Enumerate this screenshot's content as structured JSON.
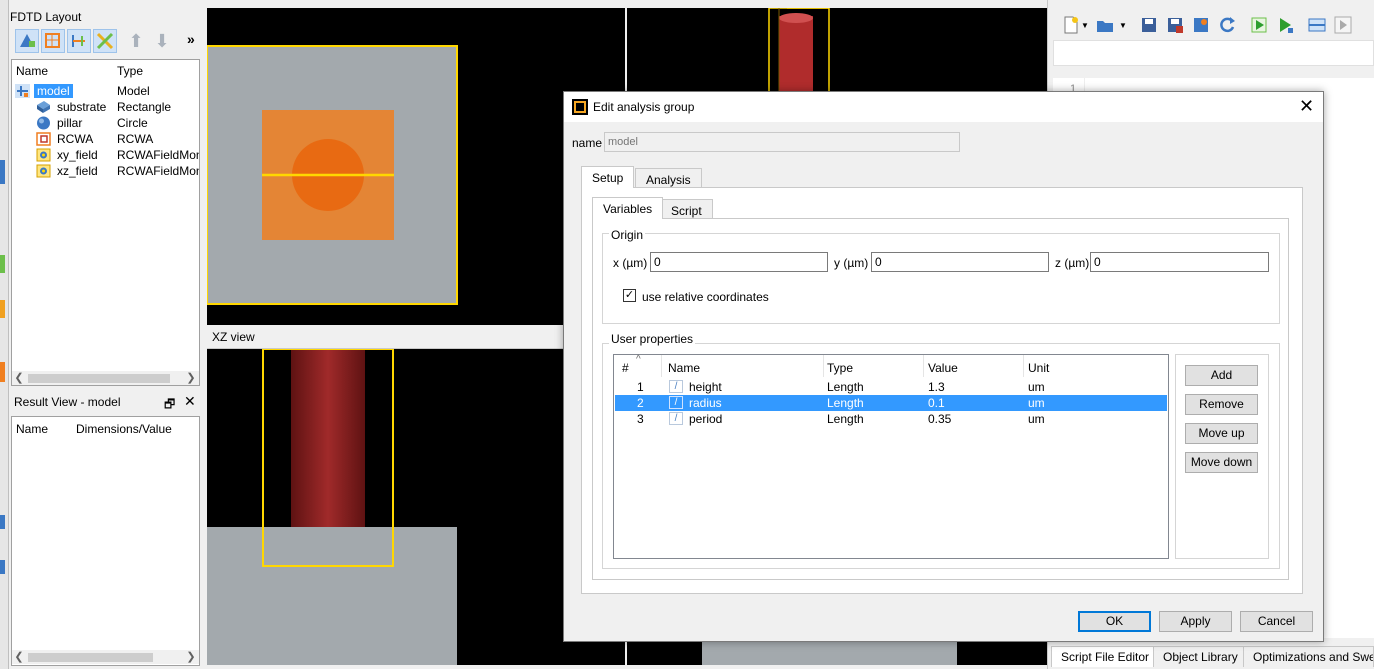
{
  "layout_panel": {
    "title": "FDTD Layout",
    "more": "»",
    "columns": {
      "name": "Name",
      "type": "Type"
    },
    "tree": [
      {
        "name": "model",
        "type": "Model",
        "icon": "model-icon",
        "selected": true
      },
      {
        "name": "substrate",
        "type": "Rectangle",
        "icon": "rectangle-icon"
      },
      {
        "name": "pillar",
        "type": "Circle",
        "icon": "circle-icon"
      },
      {
        "name": "RCWA",
        "type": "RCWA",
        "icon": "rcwa-icon"
      },
      {
        "name": "xy_field",
        "type": "RCWAFieldMon",
        "icon": "field-monitor-icon"
      },
      {
        "name": "xz_field",
        "type": "RCWAFieldMon",
        "icon": "field-monitor-icon"
      }
    ]
  },
  "result_panel": {
    "title": "Result View - model",
    "float": "🗗",
    "close": "✕",
    "columns": {
      "name": "Name",
      "value": "Dimensions/Value"
    }
  },
  "views": {
    "xz_title": "XZ view"
  },
  "script_editor": {
    "line_number": "1",
    "bottom_tabs": [
      "Script File Editor",
      "Object Library",
      "Optimizations and Sweep"
    ]
  },
  "dialog": {
    "title": "Edit analysis group",
    "close": "✕",
    "name_label": "name",
    "name_placeholder": "model",
    "tabs": [
      "Setup",
      "Analysis"
    ],
    "subtabs": [
      "Variables",
      "Script"
    ],
    "origin": {
      "label": "Origin",
      "x_label": "x (µm)",
      "x_value": "0",
      "y_label": "y (µm)",
      "y_value": "0",
      "z_label": "z (µm)",
      "z_value": "0"
    },
    "use_relative": {
      "label": "use relative coordinates",
      "checked": true,
      "mark": "✓"
    },
    "user_properties": {
      "label": "User properties",
      "sort_mark": "^",
      "columns": [
        "#",
        "Name",
        "Type",
        "Value",
        "Unit"
      ],
      "rows": [
        {
          "index": "1",
          "icon": "/",
          "name": "height",
          "type": "Length",
          "value": "1.3",
          "unit": "um"
        },
        {
          "index": "2",
          "icon": "/",
          "name": "radius",
          "type": "Length",
          "value": "0.1",
          "unit": "um",
          "selected": true
        },
        {
          "index": "3",
          "icon": "/",
          "name": "period",
          "type": "Length",
          "value": "0.35",
          "unit": "um"
        }
      ],
      "buttons": [
        "Add",
        "Remove",
        "Move up",
        "Move down"
      ]
    },
    "footer": {
      "ok": "OK",
      "apply": "Apply",
      "cancel": "Cancel"
    }
  },
  "colors": {
    "selection": "#3399ff",
    "substrate": "#a3a9ad",
    "pillar": "#f07f20",
    "monitor": "#ffd700",
    "pillar_side": "#8e1f1f"
  }
}
